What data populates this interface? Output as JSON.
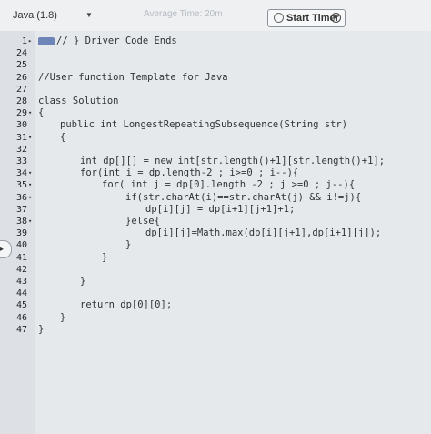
{
  "toolbar": {
    "language": "Java (1.8)",
    "average_time": "Average Time: 20m",
    "start_timer_label": "Start Timer"
  },
  "editor": {
    "lines": [
      {
        "n": "1",
        "fold": "▸",
        "indent": 1,
        "text": "// } Driver Code Ends",
        "badge": true
      },
      {
        "n": "24",
        "fold": "",
        "indent": 1,
        "text": ""
      },
      {
        "n": "25",
        "fold": "",
        "indent": 1,
        "text": ""
      },
      {
        "n": "26",
        "fold": "",
        "indent": 1,
        "text": "//User function Template for Java"
      },
      {
        "n": "27",
        "fold": "",
        "indent": 1,
        "text": ""
      },
      {
        "n": "28",
        "fold": "",
        "indent": 1,
        "text": "class Solution"
      },
      {
        "n": "29",
        "fold": "▾",
        "indent": 1,
        "text": "{"
      },
      {
        "n": "30",
        "fold": "",
        "indent": 2,
        "text": "public int LongestRepeatingSubsequence(String str)"
      },
      {
        "n": "31",
        "fold": "▾",
        "indent": 2,
        "text": "{"
      },
      {
        "n": "32",
        "fold": "",
        "indent": 2,
        "text": ""
      },
      {
        "n": "33",
        "fold": "",
        "indent": 3,
        "text": "int dp[][] = new int[str.length()+1][str.length()+1];"
      },
      {
        "n": "34",
        "fold": "▾",
        "indent": 3,
        "text": "for(int i = dp.length-2 ; i>=0 ; i--){"
      },
      {
        "n": "35",
        "fold": "▾",
        "indent": 4,
        "text": "for( int j = dp[0].length -2 ; j >=0 ; j--){"
      },
      {
        "n": "36",
        "fold": "▾",
        "indent": 5,
        "text": "if(str.charAt(i)==str.charAt(j) && i!=j){"
      },
      {
        "n": "37",
        "fold": "",
        "indent": 6,
        "text": "dp[i][j] = dp[i+1][j+1]+1;"
      },
      {
        "n": "38",
        "fold": "▾",
        "indent": 5,
        "text": "}else{"
      },
      {
        "n": "39",
        "fold": "",
        "indent": 6,
        "text": "dp[i][j]=Math.max(dp[i][j+1],dp[i+1][j]);"
      },
      {
        "n": "40",
        "fold": "",
        "indent": 5,
        "text": "}"
      },
      {
        "n": "41",
        "fold": "",
        "indent": 4,
        "text": "}"
      },
      {
        "n": "42",
        "fold": "",
        "indent": 3,
        "text": ""
      },
      {
        "n": "43",
        "fold": "",
        "indent": 3,
        "text": "}"
      },
      {
        "n": "44",
        "fold": "",
        "indent": 3,
        "text": ""
      },
      {
        "n": "45",
        "fold": "",
        "indent": 3,
        "text": "return dp[0][0];"
      },
      {
        "n": "46",
        "fold": "",
        "indent": 2,
        "text": "}"
      },
      {
        "n": "47",
        "fold": "",
        "indent": 1,
        "text": "}"
      }
    ]
  }
}
